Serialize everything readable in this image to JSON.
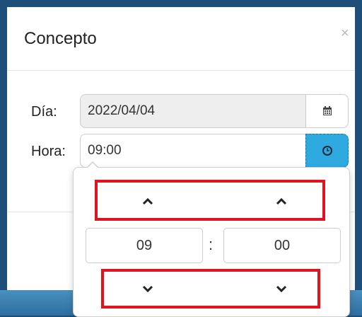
{
  "modal": {
    "title": "Concepto",
    "close_symbol": "×"
  },
  "form": {
    "dia_label": "Día:",
    "dia_value": "2022/04/04",
    "hora_label": "Hora:",
    "hora_value": "09:00"
  },
  "timepicker": {
    "hours": "09",
    "separator": ":",
    "minutes": "00"
  },
  "colors": {
    "accent": "#2eaae1",
    "highlight": "#e0141e",
    "backdrop": "#1d4f7a"
  },
  "icons": {
    "dia_addon": "calendar-icon",
    "hora_addon": "clock-icon",
    "increment": "chevron-up-icon",
    "decrement": "chevron-down-icon"
  }
}
